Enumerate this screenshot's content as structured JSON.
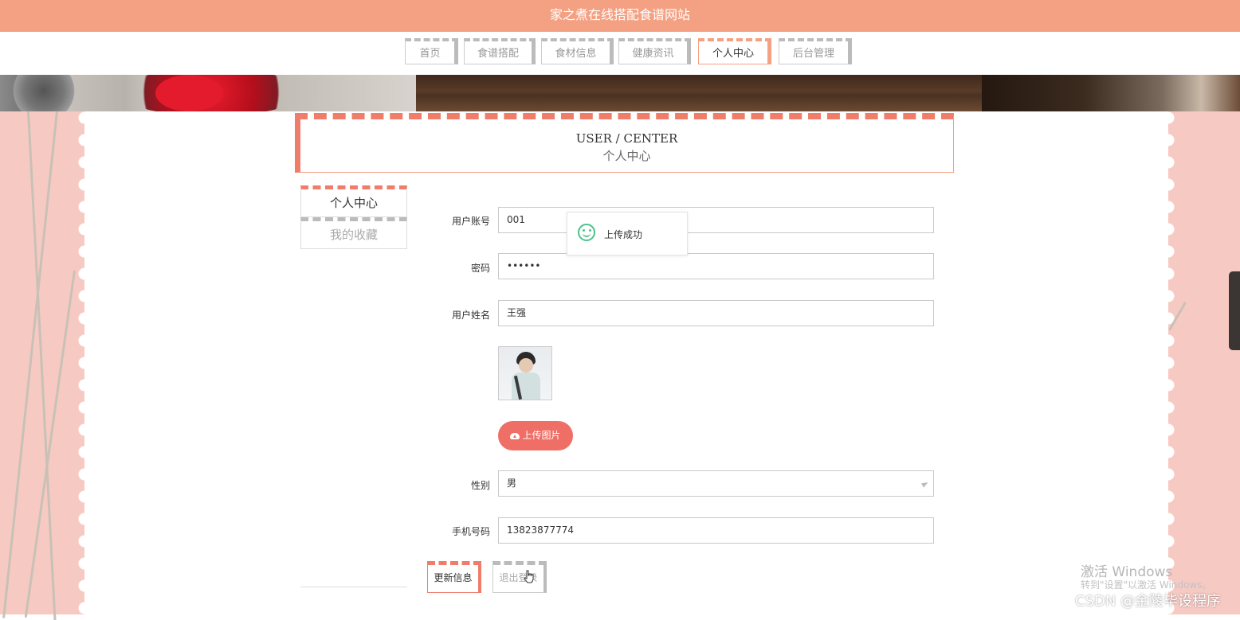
{
  "site": {
    "title": "家之煮在线搭配食谱网站"
  },
  "nav": {
    "items": [
      {
        "label": "首页"
      },
      {
        "label": "食谱搭配"
      },
      {
        "label": "食材信息"
      },
      {
        "label": "健康资讯"
      },
      {
        "label": "个人中心",
        "active": true
      },
      {
        "label": "后台管理"
      }
    ]
  },
  "header": {
    "en": "USER / CENTER",
    "cn": "个人中心"
  },
  "side_menu": {
    "items": [
      {
        "label": "个人中心",
        "active": true
      },
      {
        "label": "我的收藏"
      }
    ]
  },
  "form": {
    "account_label": "用户账号",
    "account_value": "001",
    "password_label": "密码",
    "password_value": "••••••",
    "name_label": "用户姓名",
    "name_value": "王强",
    "upload_label": "上传图片",
    "gender_label": "性别",
    "gender_value": "男",
    "phone_label": "手机号码",
    "phone_value": "13823877774",
    "update_label": "更新信息",
    "logout_label": "退出登录"
  },
  "toast": {
    "message": "上传成功"
  },
  "watermark": {
    "activate_title": "激活 Windows",
    "activate_hint": "转到\"设置\"以激活 Windows。",
    "credit": "CSDN @金陵毕设程序"
  },
  "colors": {
    "accent": "#f4a183",
    "button": "#ef6f66",
    "success": "#4cc28a",
    "side": "#f7c9c3"
  }
}
